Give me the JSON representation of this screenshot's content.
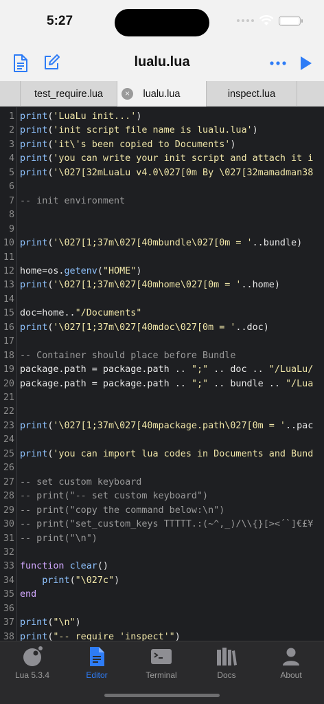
{
  "status": {
    "time": "5:27"
  },
  "header": {
    "title": "lualu.lua",
    "icons": [
      "document-icon",
      "edit-icon",
      "more-icon",
      "run-icon"
    ]
  },
  "tabs": [
    {
      "label": "test_require.lua"
    },
    {
      "label": "lualu.lua",
      "close": "×"
    },
    {
      "label": "inspect.lua"
    }
  ],
  "colors": {
    "accent": "#2e7cf6",
    "editor_bg": "#1e1f22",
    "function": "#8fc3ff",
    "string": "#f0e6a8",
    "comment": "#9a9a9a",
    "keyword": "#d2a8ff"
  },
  "editor": {
    "lines": [
      {
        "n": "1",
        "tokens": [
          [
            "fn",
            "print"
          ],
          [
            "txt",
            "("
          ],
          [
            "str",
            "'LuaLu init...'"
          ],
          [
            "txt",
            ")"
          ]
        ]
      },
      {
        "n": "2",
        "tokens": [
          [
            "fn",
            "print"
          ],
          [
            "txt",
            "("
          ],
          [
            "str",
            "'init script file name is lualu.lua'"
          ],
          [
            "txt",
            ")"
          ]
        ]
      },
      {
        "n": "3",
        "tokens": [
          [
            "fn",
            "print"
          ],
          [
            "txt",
            "("
          ],
          [
            "str",
            "'it\\'s been copied to Documents'"
          ],
          [
            "txt",
            ")"
          ]
        ]
      },
      {
        "n": "4",
        "tokens": [
          [
            "fn",
            "print"
          ],
          [
            "txt",
            "("
          ],
          [
            "str",
            "'you can write your init script and attach it i"
          ]
        ]
      },
      {
        "n": "5",
        "tokens": [
          [
            "fn",
            "print"
          ],
          [
            "txt",
            "("
          ],
          [
            "str",
            "'\\027[32mLuaLu v4.0\\027[0m By \\027[32mamadman38"
          ]
        ]
      },
      {
        "n": "6",
        "tokens": []
      },
      {
        "n": "7",
        "tokens": [
          [
            "com",
            "-- init environment"
          ]
        ]
      },
      {
        "n": "8",
        "tokens": []
      },
      {
        "n": "9",
        "tokens": []
      },
      {
        "n": "10",
        "tokens": [
          [
            "fn",
            "print"
          ],
          [
            "txt",
            "("
          ],
          [
            "str",
            "'\\027[1;37m\\027[40mbundle\\027[0m = '"
          ],
          [
            "txt",
            "..bundle)"
          ]
        ]
      },
      {
        "n": "11",
        "tokens": []
      },
      {
        "n": "12",
        "tokens": [
          [
            "txt",
            "home=os."
          ],
          [
            "fn",
            "getenv"
          ],
          [
            "txt",
            "("
          ],
          [
            "str",
            "\"HOME\""
          ],
          [
            "txt",
            ")"
          ]
        ]
      },
      {
        "n": "13",
        "tokens": [
          [
            "fn",
            "print"
          ],
          [
            "txt",
            "("
          ],
          [
            "str",
            "'\\027[1;37m\\027[40mhome\\027[0m = '"
          ],
          [
            "txt",
            "..home)"
          ]
        ]
      },
      {
        "n": "14",
        "tokens": []
      },
      {
        "n": "15",
        "tokens": [
          [
            "txt",
            "doc=home.."
          ],
          [
            "str",
            "\"/Documents\""
          ]
        ]
      },
      {
        "n": "16",
        "tokens": [
          [
            "fn",
            "print"
          ],
          [
            "txt",
            "("
          ],
          [
            "str",
            "'\\027[1;37m\\027[40mdoc\\027[0m = '"
          ],
          [
            "txt",
            "..doc)"
          ]
        ]
      },
      {
        "n": "17",
        "tokens": []
      },
      {
        "n": "18",
        "tokens": [
          [
            "com",
            "-- Container should place before Bundle"
          ]
        ]
      },
      {
        "n": "19",
        "tokens": [
          [
            "txt",
            "package.path = package.path .. "
          ],
          [
            "str",
            "\";\""
          ],
          [
            "txt",
            " .. doc .. "
          ],
          [
            "str",
            "\"/LuaLu/"
          ]
        ]
      },
      {
        "n": "20",
        "tokens": [
          [
            "txt",
            "package.path = package.path .. "
          ],
          [
            "str",
            "\";\""
          ],
          [
            "txt",
            " .. bundle .. "
          ],
          [
            "str",
            "\"/Lua"
          ]
        ]
      },
      {
        "n": "21",
        "tokens": []
      },
      {
        "n": "22",
        "tokens": []
      },
      {
        "n": "23",
        "tokens": [
          [
            "fn",
            "print"
          ],
          [
            "txt",
            "("
          ],
          [
            "str",
            "'\\027[1;37m\\027[40mpackage.path\\027[0m = '"
          ],
          [
            "txt",
            "..pac"
          ]
        ]
      },
      {
        "n": "24",
        "tokens": []
      },
      {
        "n": "25",
        "tokens": [
          [
            "fn",
            "print"
          ],
          [
            "txt",
            "("
          ],
          [
            "str",
            "'you can import lua codes in Documents and Bund"
          ]
        ]
      },
      {
        "n": "26",
        "tokens": []
      },
      {
        "n": "27",
        "tokens": [
          [
            "com",
            "-- set custom keyboard"
          ]
        ]
      },
      {
        "n": "28",
        "tokens": [
          [
            "com",
            "-- print(\"-- set custom keyboard\")"
          ]
        ]
      },
      {
        "n": "29",
        "tokens": [
          [
            "com",
            "-- print(\"copy the command below:\\n\")"
          ]
        ]
      },
      {
        "n": "30",
        "tokens": [
          [
            "com",
            "-- print(\"set_custom_keys TTTTT.:(~^,_)/\\\\{}[><´`]€£¥"
          ]
        ]
      },
      {
        "n": "31",
        "tokens": [
          [
            "com",
            "-- print(\"\\n\")"
          ]
        ]
      },
      {
        "n": "32",
        "tokens": []
      },
      {
        "n": "33",
        "tokens": [
          [
            "kw",
            "function"
          ],
          [
            "txt",
            " "
          ],
          [
            "fn",
            "clear"
          ],
          [
            "txt",
            "()"
          ]
        ]
      },
      {
        "n": "34",
        "tokens": [
          [
            "txt",
            "    "
          ],
          [
            "fn",
            "print"
          ],
          [
            "txt",
            "("
          ],
          [
            "str",
            "\"\\027c\""
          ],
          [
            "txt",
            ")"
          ]
        ]
      },
      {
        "n": "35",
        "tokens": [
          [
            "kw",
            "end"
          ]
        ]
      },
      {
        "n": "36",
        "tokens": []
      },
      {
        "n": "37",
        "tokens": [
          [
            "fn",
            "print"
          ],
          [
            "txt",
            "("
          ],
          [
            "str",
            "\"\\n\""
          ],
          [
            "txt",
            ")"
          ]
        ]
      },
      {
        "n": "38",
        "tokens": [
          [
            "fn",
            "print"
          ],
          [
            "txt",
            "("
          ],
          [
            "str",
            "\"-- require 'inspect'\""
          ],
          [
            "txt",
            ")"
          ]
        ]
      }
    ]
  },
  "bottom_tabs": [
    {
      "label": "Lua 5.3.4",
      "icon": "lua-logo-icon"
    },
    {
      "label": "Editor",
      "icon": "document-icon",
      "active": true
    },
    {
      "label": "Terminal",
      "icon": "terminal-icon"
    },
    {
      "label": "Docs",
      "icon": "books-icon"
    },
    {
      "label": "About",
      "icon": "person-icon"
    }
  ]
}
